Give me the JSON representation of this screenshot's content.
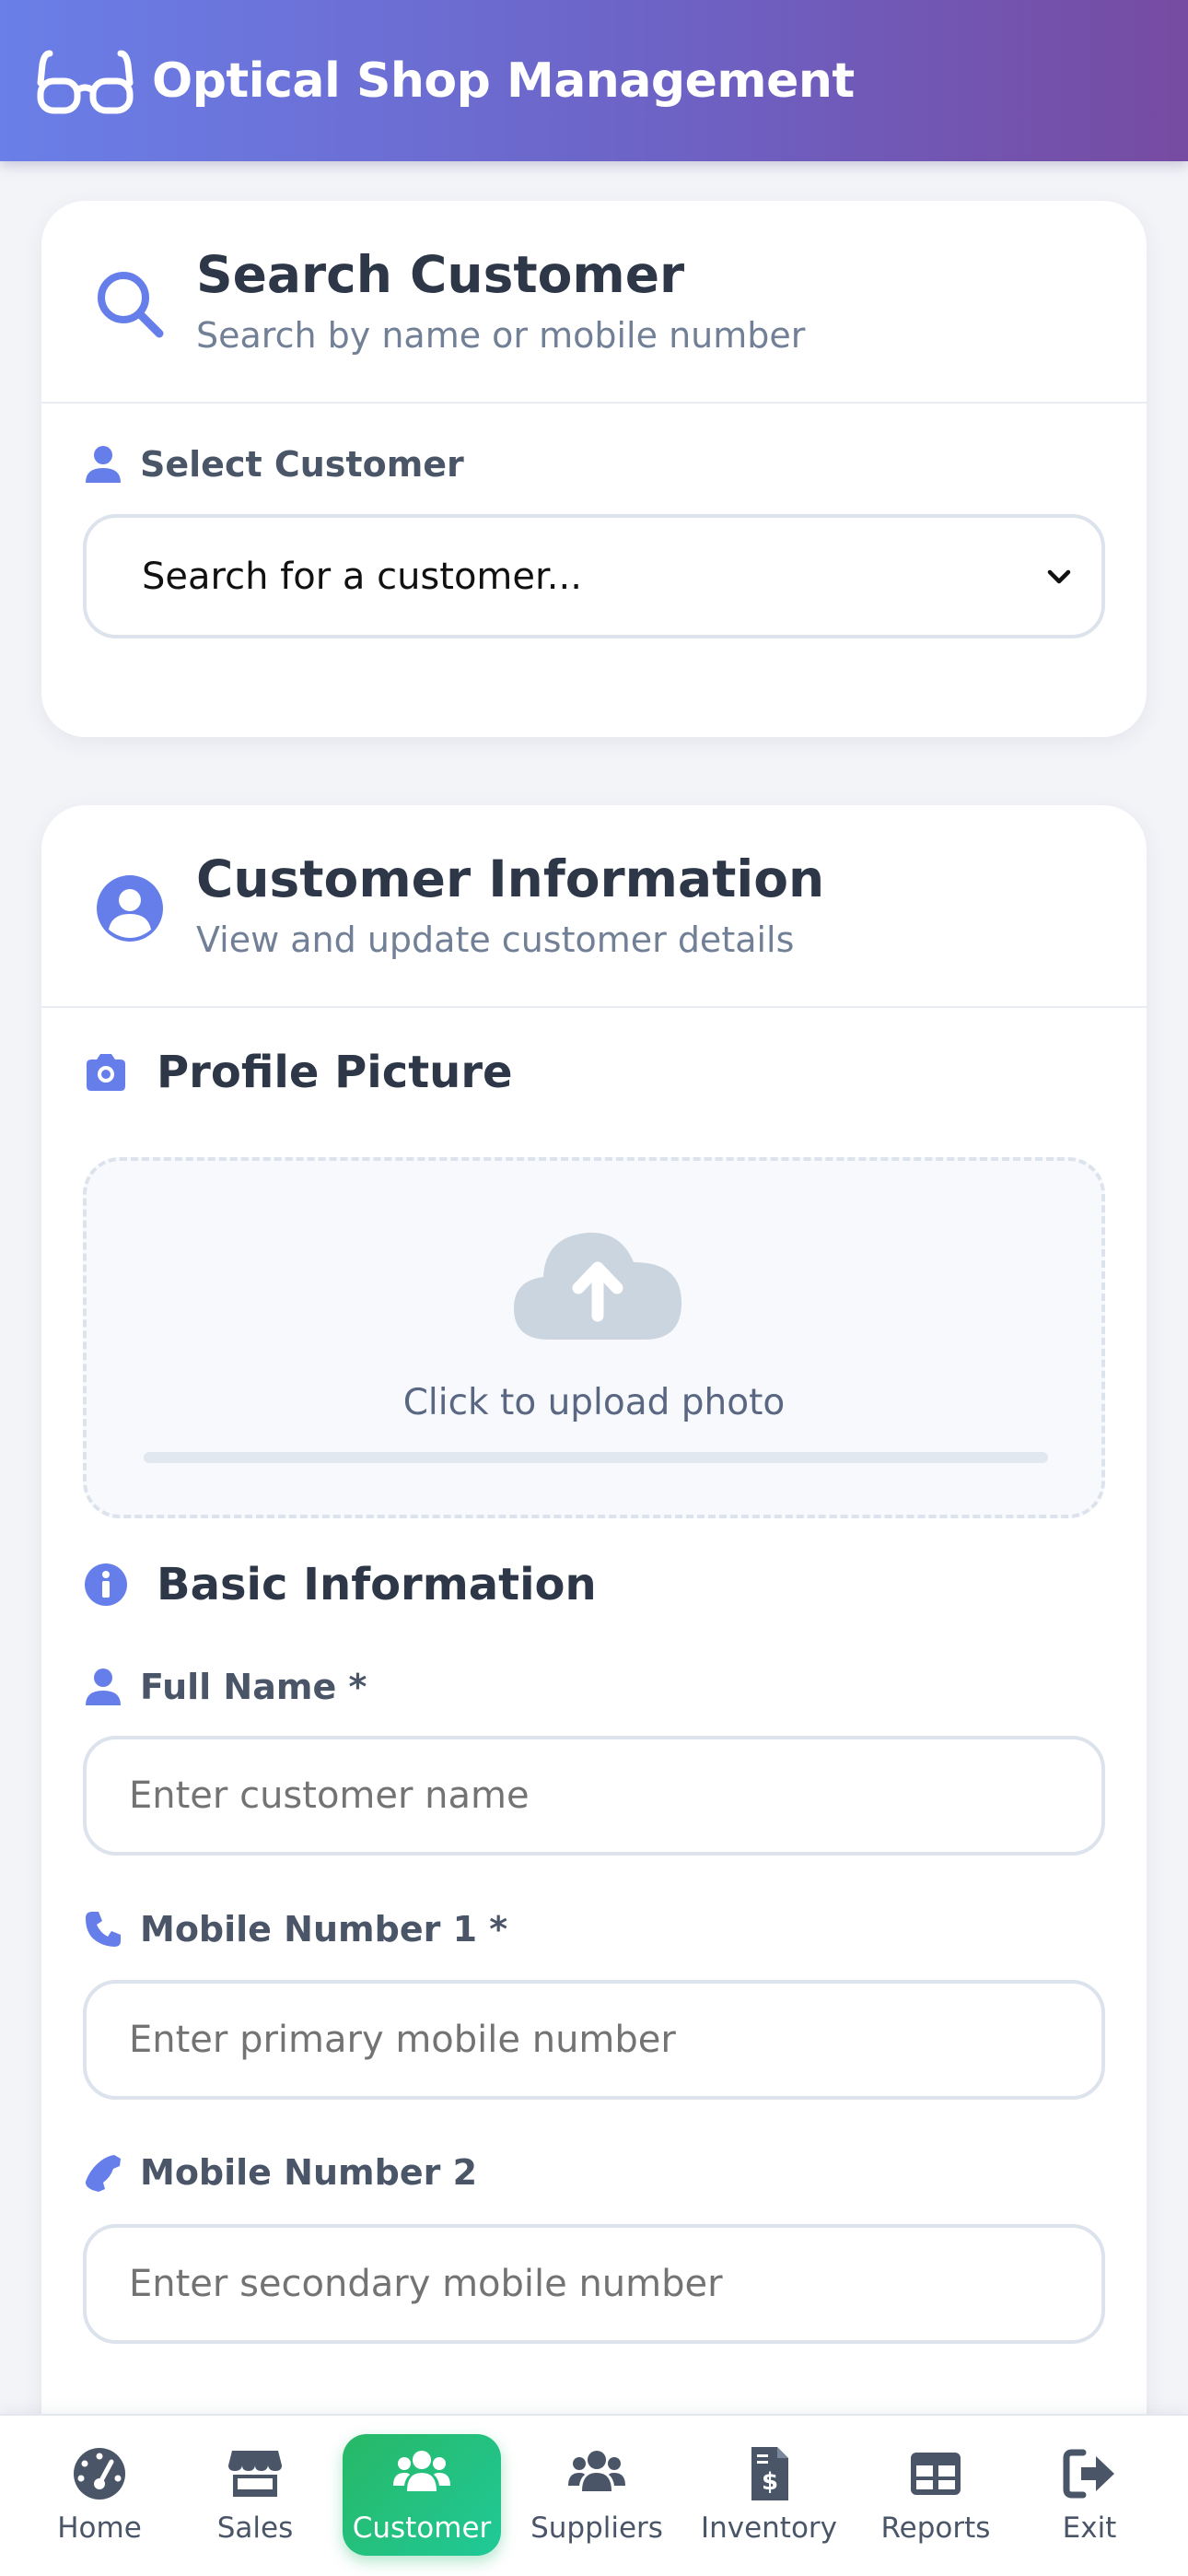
{
  "app": {
    "title": "Optical Shop Management",
    "icon": "glasses-icon"
  },
  "search_card": {
    "title": "Search Customer",
    "subtitle": "Search by name or mobile number",
    "select_label": "Select Customer",
    "select_value": "Search for a customer..."
  },
  "info_card": {
    "title": "Customer Information",
    "subtitle": "View and update customer details",
    "profile_section": "Profile Picture",
    "upload_text": "Click to upload photo",
    "upload_progress": 0,
    "basic_section": "Basic Information",
    "fields": [
      {
        "label": "Full Name *",
        "placeholder": "Enter customer name"
      },
      {
        "label": "Mobile Number 1 *",
        "placeholder": "Enter primary mobile number"
      },
      {
        "label": "Mobile Number 2",
        "placeholder": "Enter secondary mobile number"
      }
    ]
  },
  "nav": {
    "items": [
      {
        "label": "Home",
        "icon": "gauge-icon"
      },
      {
        "label": "Sales",
        "icon": "store-icon"
      },
      {
        "label": "Customer",
        "icon": "users-icon",
        "active": true
      },
      {
        "label": "Suppliers",
        "icon": "suppliers-icon"
      },
      {
        "label": "Inventory",
        "icon": "invoice-icon"
      },
      {
        "label": "Reports",
        "icon": "table-icon"
      },
      {
        "label": "Exit",
        "icon": "sign-out-icon"
      }
    ]
  },
  "colors": {
    "accent": "#667eea",
    "active_nav": "#27b866",
    "header_start": "#6a7fe8",
    "header_end": "#764ba2"
  }
}
